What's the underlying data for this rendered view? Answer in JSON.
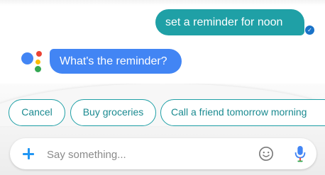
{
  "conversation": {
    "user_message": "set a reminder for noon",
    "assistant_message": "What's the reminder?"
  },
  "suggestions": [
    {
      "label": "Cancel"
    },
    {
      "label": "Buy groceries"
    },
    {
      "label": "Call a friend tomorrow morning"
    }
  ],
  "composer": {
    "placeholder": "Say something...",
    "add_icon": "plus-icon",
    "emoji_icon": "emoji-icon",
    "mic_icon": "mic-icon"
  },
  "colors": {
    "user_bubble": "#1fa0a6",
    "assistant_bubble": "#4285f4",
    "chip_border": "#1fa0a6",
    "accent_blue": "#2196f3",
    "logo": [
      "#4285f4",
      "#ea4335",
      "#fbbc05",
      "#34a853"
    ]
  }
}
